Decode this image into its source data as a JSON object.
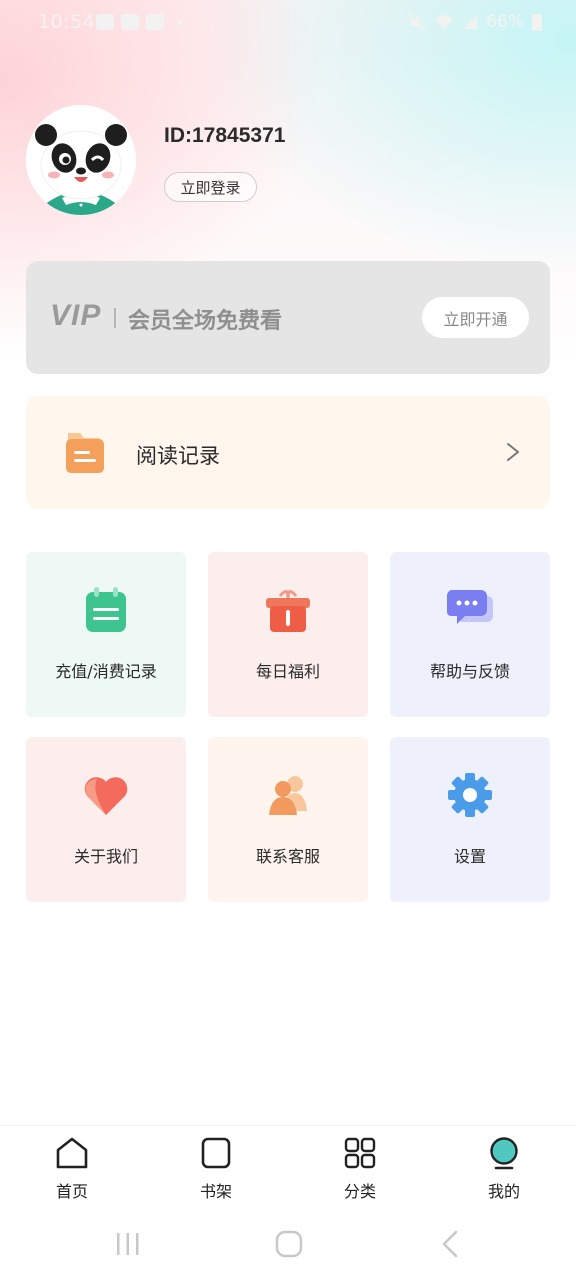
{
  "status_bar": {
    "time": "10:54",
    "battery": "66%"
  },
  "profile": {
    "user_id": "ID:17845371",
    "login_label": "立即登录"
  },
  "vip": {
    "logo": "VIP",
    "text": "会员全场免费看",
    "button_label": "立即开通"
  },
  "reading": {
    "label": "阅读记录",
    "icon": "folder-icon"
  },
  "grid": {
    "items": [
      {
        "label": "充值/消费记录",
        "icon": "calendar-icon",
        "bg": "#eef8f4",
        "color": "#3ec48f"
      },
      {
        "label": "每日福利",
        "icon": "gift-icon",
        "bg": "#fdeeee",
        "color": "#ee6a4e"
      },
      {
        "label": "帮助与反馈",
        "icon": "chat-bubble-icon",
        "bg": "#eef0fc",
        "color": "#7b7ef0"
      },
      {
        "label": "关于我们",
        "icon": "heart-icon",
        "bg": "#fdeeee",
        "color": "#f46a5c"
      },
      {
        "label": "联系客服",
        "icon": "customer-service-icon",
        "bg": "#fff5ee",
        "color": "#f39a5e"
      },
      {
        "label": "设置",
        "icon": "gear-icon",
        "bg": "#eef0fc",
        "color": "#4a9be8"
      }
    ]
  },
  "bottom_nav": {
    "items": [
      {
        "label": "首页",
        "icon": "home-icon"
      },
      {
        "label": "书架",
        "icon": "bookshelf-icon"
      },
      {
        "label": "分类",
        "icon": "category-grid-icon"
      },
      {
        "label": "我的",
        "icon": "profile-globe-icon",
        "active": true
      }
    ]
  },
  "colors": {
    "accent": "#4fc9c0",
    "text_primary": "#2a2a2a",
    "vip_card": "#e5e5e5",
    "reading_card": "#fff6ee"
  }
}
